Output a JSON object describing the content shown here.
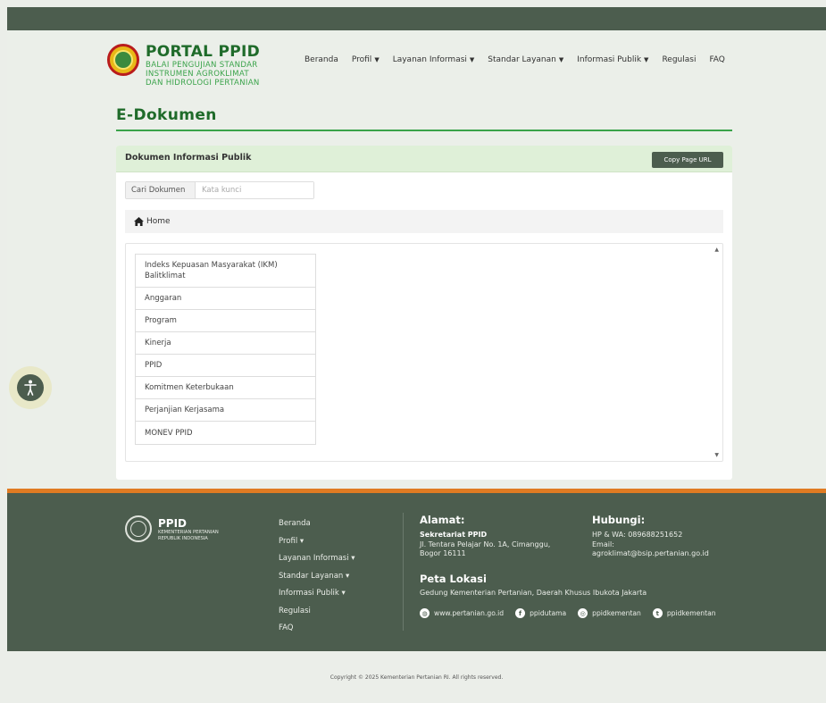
{
  "header": {
    "brand_title": "PORTAL PPID",
    "brand_sub_1": "BALAI PENGUJIAN STANDAR",
    "brand_sub_2": "INSTRUMEN AGROKLIMAT",
    "brand_sub_3": "DAN HIDROLOGI PERTANIAN"
  },
  "nav": {
    "items": [
      {
        "label": "Beranda",
        "dropdown": false
      },
      {
        "label": "Profil",
        "dropdown": true
      },
      {
        "label": "Layanan Informasi",
        "dropdown": true
      },
      {
        "label": "Standar Layanan",
        "dropdown": true
      },
      {
        "label": "Informasi Publik",
        "dropdown": true
      },
      {
        "label": "Regulasi",
        "dropdown": false
      },
      {
        "label": "FAQ",
        "dropdown": false
      }
    ],
    "caret": "▼"
  },
  "page": {
    "title": "E-Dokumen"
  },
  "card": {
    "title": "Dokumen Informasi Publik",
    "copy_button": "Copy Page URL",
    "search_label": "Cari Dokumen",
    "search_placeholder": "Kata kunci",
    "search_value": "",
    "breadcrumb_home": "Home",
    "scroll_up": "▲",
    "scroll_down": "▼",
    "documents": [
      "Indeks Kepuasan Masyarakat (IKM) Balitklimat",
      "Anggaran",
      "Program",
      "Kinerja",
      "PPID",
      "Komitmen Keterbukaan",
      "Perjanjian Kerjasama",
      "MONEV PPID"
    ]
  },
  "footer": {
    "brand": "PPID",
    "brand_sub_1": "KEMENTERIAN PERTANIAN",
    "brand_sub_2": "REPUBLIK INDONESIA",
    "nav": [
      "Beranda",
      "Profil ▾",
      "Layanan Informasi ▾",
      "Standar Layanan ▾",
      "Informasi Publik ▾",
      "Regulasi",
      "FAQ"
    ],
    "alamat_head": "Alamat:",
    "alamat_org": "Sekretariat PPID",
    "alamat_line1": "Jl. Tentara Pelajar No. 1A, Cimanggu,",
    "alamat_line2": "Bogor 16111",
    "hubungi_head": "Hubungi:",
    "hubungi_phone": "HP & WA: 089688251652",
    "hubungi_email_label": "Email:",
    "hubungi_email": "agroklimat@bsip.pertanian.go.id",
    "peta_head": "Peta Lokasi",
    "peta_text": "Gedung Kementerian Pertanian, Daerah Khusus Ibukota Jakarta",
    "social": [
      {
        "icon": "globe-icon",
        "glyph": "◍",
        "label": "www.pertanian.go.id"
      },
      {
        "icon": "facebook-icon",
        "glyph": "f",
        "label": "ppidutama"
      },
      {
        "icon": "instagram-icon",
        "glyph": "◎",
        "label": "ppidkementan"
      },
      {
        "icon": "twitter-icon",
        "glyph": "t",
        "label": "ppidkementan"
      }
    ]
  },
  "copyright": "Copyright © 2025 Kementerian Pertanian RI. All rights reserved.",
  "colors": {
    "brand_green": "#1f6b2a",
    "accent_green": "#3aa34a",
    "footer_bg": "#4c5d4e",
    "footer_accent": "#e07b22"
  }
}
